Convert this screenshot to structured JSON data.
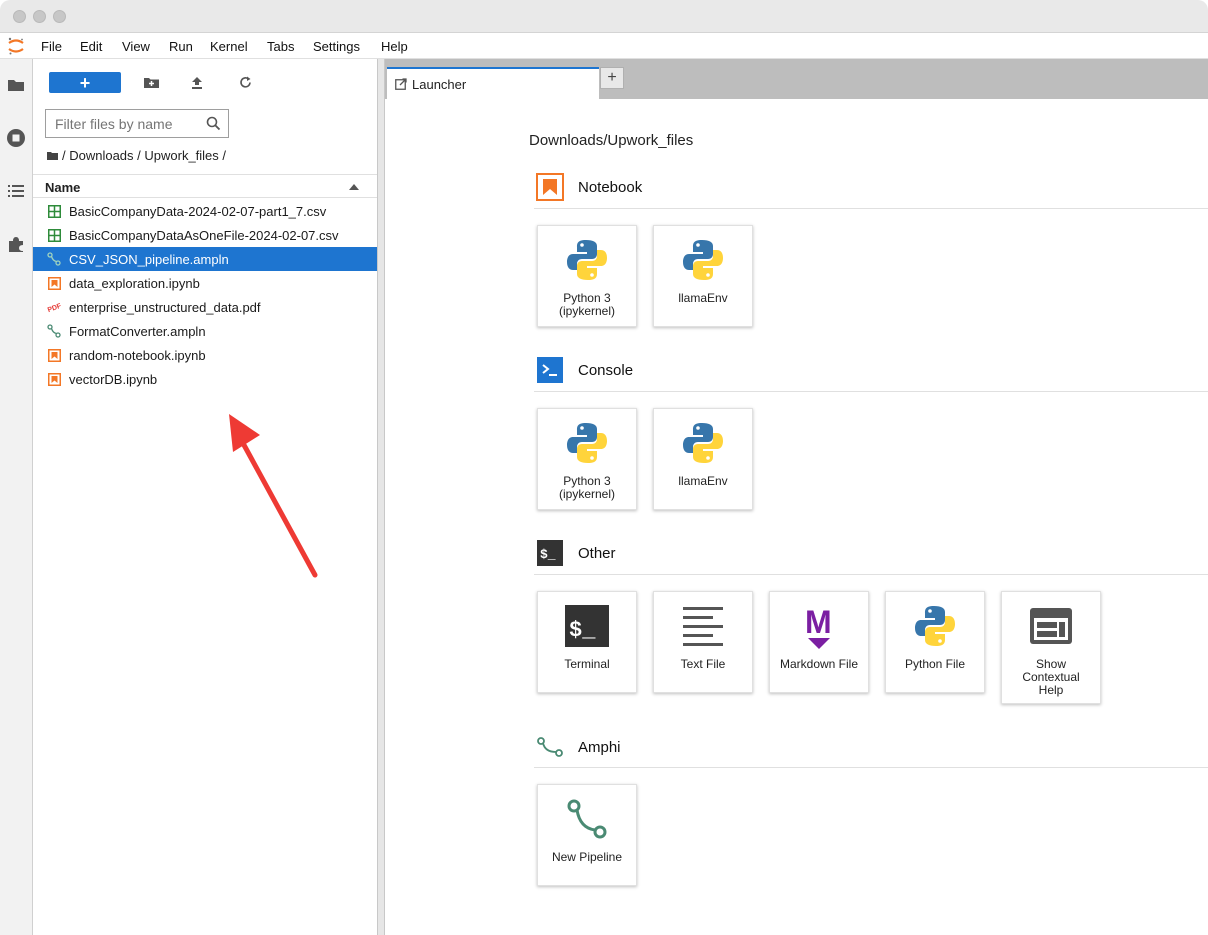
{
  "menubar": {
    "items": [
      "File",
      "Edit",
      "View",
      "Run",
      "Kernel",
      "Tabs",
      "Settings",
      "Help"
    ]
  },
  "filebrowser": {
    "new_button_label": "+",
    "filter_placeholder": "Filter files by name",
    "breadcrumb": "/ Downloads / Upwork_files /",
    "column_name": "Name",
    "files": [
      {
        "name": "BasicCompanyData-2024-02-07-part1_7.csv",
        "icon": "csv-icon",
        "selected": false
      },
      {
        "name": "BasicCompanyDataAsOneFile-2024-02-07.csv",
        "icon": "csv-icon",
        "selected": false
      },
      {
        "name": "CSV_JSON_pipeline.ampln",
        "icon": "pipeline-icon",
        "selected": true
      },
      {
        "name": "data_exploration.ipynb",
        "icon": "notebook-icon",
        "selected": false
      },
      {
        "name": "enterprise_unstructured_data.pdf",
        "icon": "pdf-icon",
        "selected": false
      },
      {
        "name": "FormatConverter.ampln",
        "icon": "pipeline-icon",
        "selected": false
      },
      {
        "name": "random-notebook.ipynb",
        "icon": "notebook-icon",
        "selected": false
      },
      {
        "name": "vectorDB.ipynb",
        "icon": "notebook-icon",
        "selected": false
      }
    ]
  },
  "tabs": {
    "active": "Launcher",
    "add_label": "+"
  },
  "launcher": {
    "path": "Downloads/Upwork_files",
    "sections": [
      {
        "title": "Notebook",
        "icon": "notebook-section-icon",
        "cards": [
          {
            "label": "Python 3\n(ipykernel)",
            "icon": "python-icon"
          },
          {
            "label": "llamaEnv",
            "icon": "python-icon"
          }
        ]
      },
      {
        "title": "Console",
        "icon": "console-section-icon",
        "cards": [
          {
            "label": "Python 3\n(ipykernel)",
            "icon": "python-icon"
          },
          {
            "label": "llamaEnv",
            "icon": "python-icon"
          }
        ]
      },
      {
        "title": "Other",
        "icon": "other-section-icon",
        "cards": [
          {
            "label": "Terminal",
            "icon": "terminal-icon"
          },
          {
            "label": "Text File",
            "icon": "text-file-icon"
          },
          {
            "label": "Markdown File",
            "icon": "markdown-icon"
          },
          {
            "label": "Python File",
            "icon": "python-icon"
          },
          {
            "label": "Show\nContextual\nHelp",
            "icon": "contextual-help-icon"
          }
        ]
      },
      {
        "title": "Amphi",
        "icon": "amphi-section-icon",
        "cards": [
          {
            "label": "New Pipeline",
            "icon": "pipeline-icon"
          }
        ]
      }
    ]
  },
  "colors": {
    "accent": "#1e75d0",
    "annotation_arrow": "#ee3a34",
    "notebook_orange": "#f37726",
    "csv_green": "#2e8b3a",
    "pipeline_green": "#4a8a73",
    "python_blue": "#3776ab",
    "python_yellow": "#ffd43b",
    "markdown_purple": "#7b1fa2"
  }
}
